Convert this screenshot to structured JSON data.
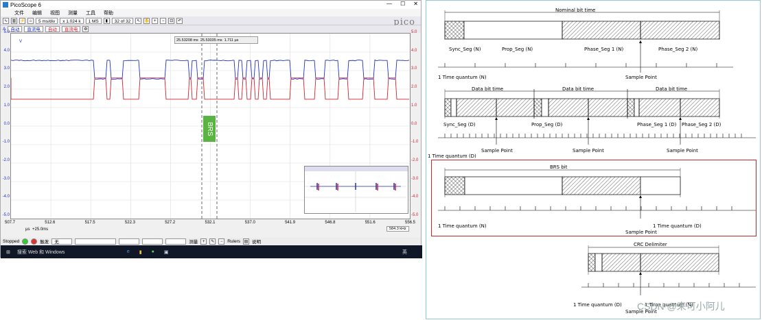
{
  "app": {
    "title": "PicoScope 6",
    "window_controls": [
      "—",
      "☐",
      "✕"
    ]
  },
  "menu": [
    "文件",
    "编辑",
    "视图",
    "测量",
    "工具",
    "帮助"
  ],
  "toolbar": {
    "timebase": "5 ms/div",
    "zoom": "x 1.024 k",
    "samples": "1 MS",
    "buffer": "32 of 32",
    "chA_label": "A",
    "chA_range": "自动",
    "chA_coupling": "直流电",
    "chB_range": "自动",
    "chB_coupling": "直流电"
  },
  "logo": "pico",
  "ruler": {
    "t1": "25.53208 ms",
    "t2": "25.53035 ms",
    "dt": "1.711 µs"
  },
  "yaxis_left": [
    "5.0",
    "4.0",
    "3.0",
    "2.0",
    "1.0",
    "0.0",
    "-1.0",
    "-2.0",
    "-3.0",
    "-4.0",
    "-5.0"
  ],
  "yaxis_right": [
    "5.0",
    "4.0",
    "3.0",
    "2.0",
    "1.0",
    "0.0",
    "-1.0",
    "-2.0",
    "-3.0",
    "-4.0",
    "-5.0"
  ],
  "unit": "V",
  "xaxis": [
    "507.7",
    "512.6",
    "517.5",
    "522.3",
    "527.2",
    "532.1",
    "537.0",
    "541.9",
    "546.8",
    "551.6",
    "556.5"
  ],
  "xunit": "µs",
  "xoffset": "+25.0ms",
  "freq_box": "584.3 kHz",
  "brs_label": "BRS",
  "status": {
    "state": "Stopped",
    "trigger": "触发",
    "mode": "无",
    "measure": "测量",
    "rulers": "Rulers",
    "notes": "说明"
  },
  "taskbar": {
    "search": "搜索 Web 和 Windows",
    "lang": "英"
  },
  "diagram": {
    "nominal": "Nominal bit time",
    "sync_n": "Sync_Seg (N)",
    "prop_n": "Prop_Seg (N)",
    "ph1_n": "Phase_Seg 1 (N)",
    "ph2_n": "Phase_Seg 2 (N)",
    "tq_n": "1 Time quantum (N)",
    "sample": "Sample Point",
    "data_bit": "Data bit time",
    "sync_d": "Sync_Seg (D)",
    "prop_d": "Prop_Seg (D)",
    "ph1_d": "Phase_Seg 1 (D)",
    "ph2_d": "Phase_Seg 2 (D)",
    "tq_d": "1 Time quantum (D)",
    "brs": "BRS bit",
    "crc": "CRC Delimiter"
  },
  "watermark": "CSDN @来可小阿儿"
}
